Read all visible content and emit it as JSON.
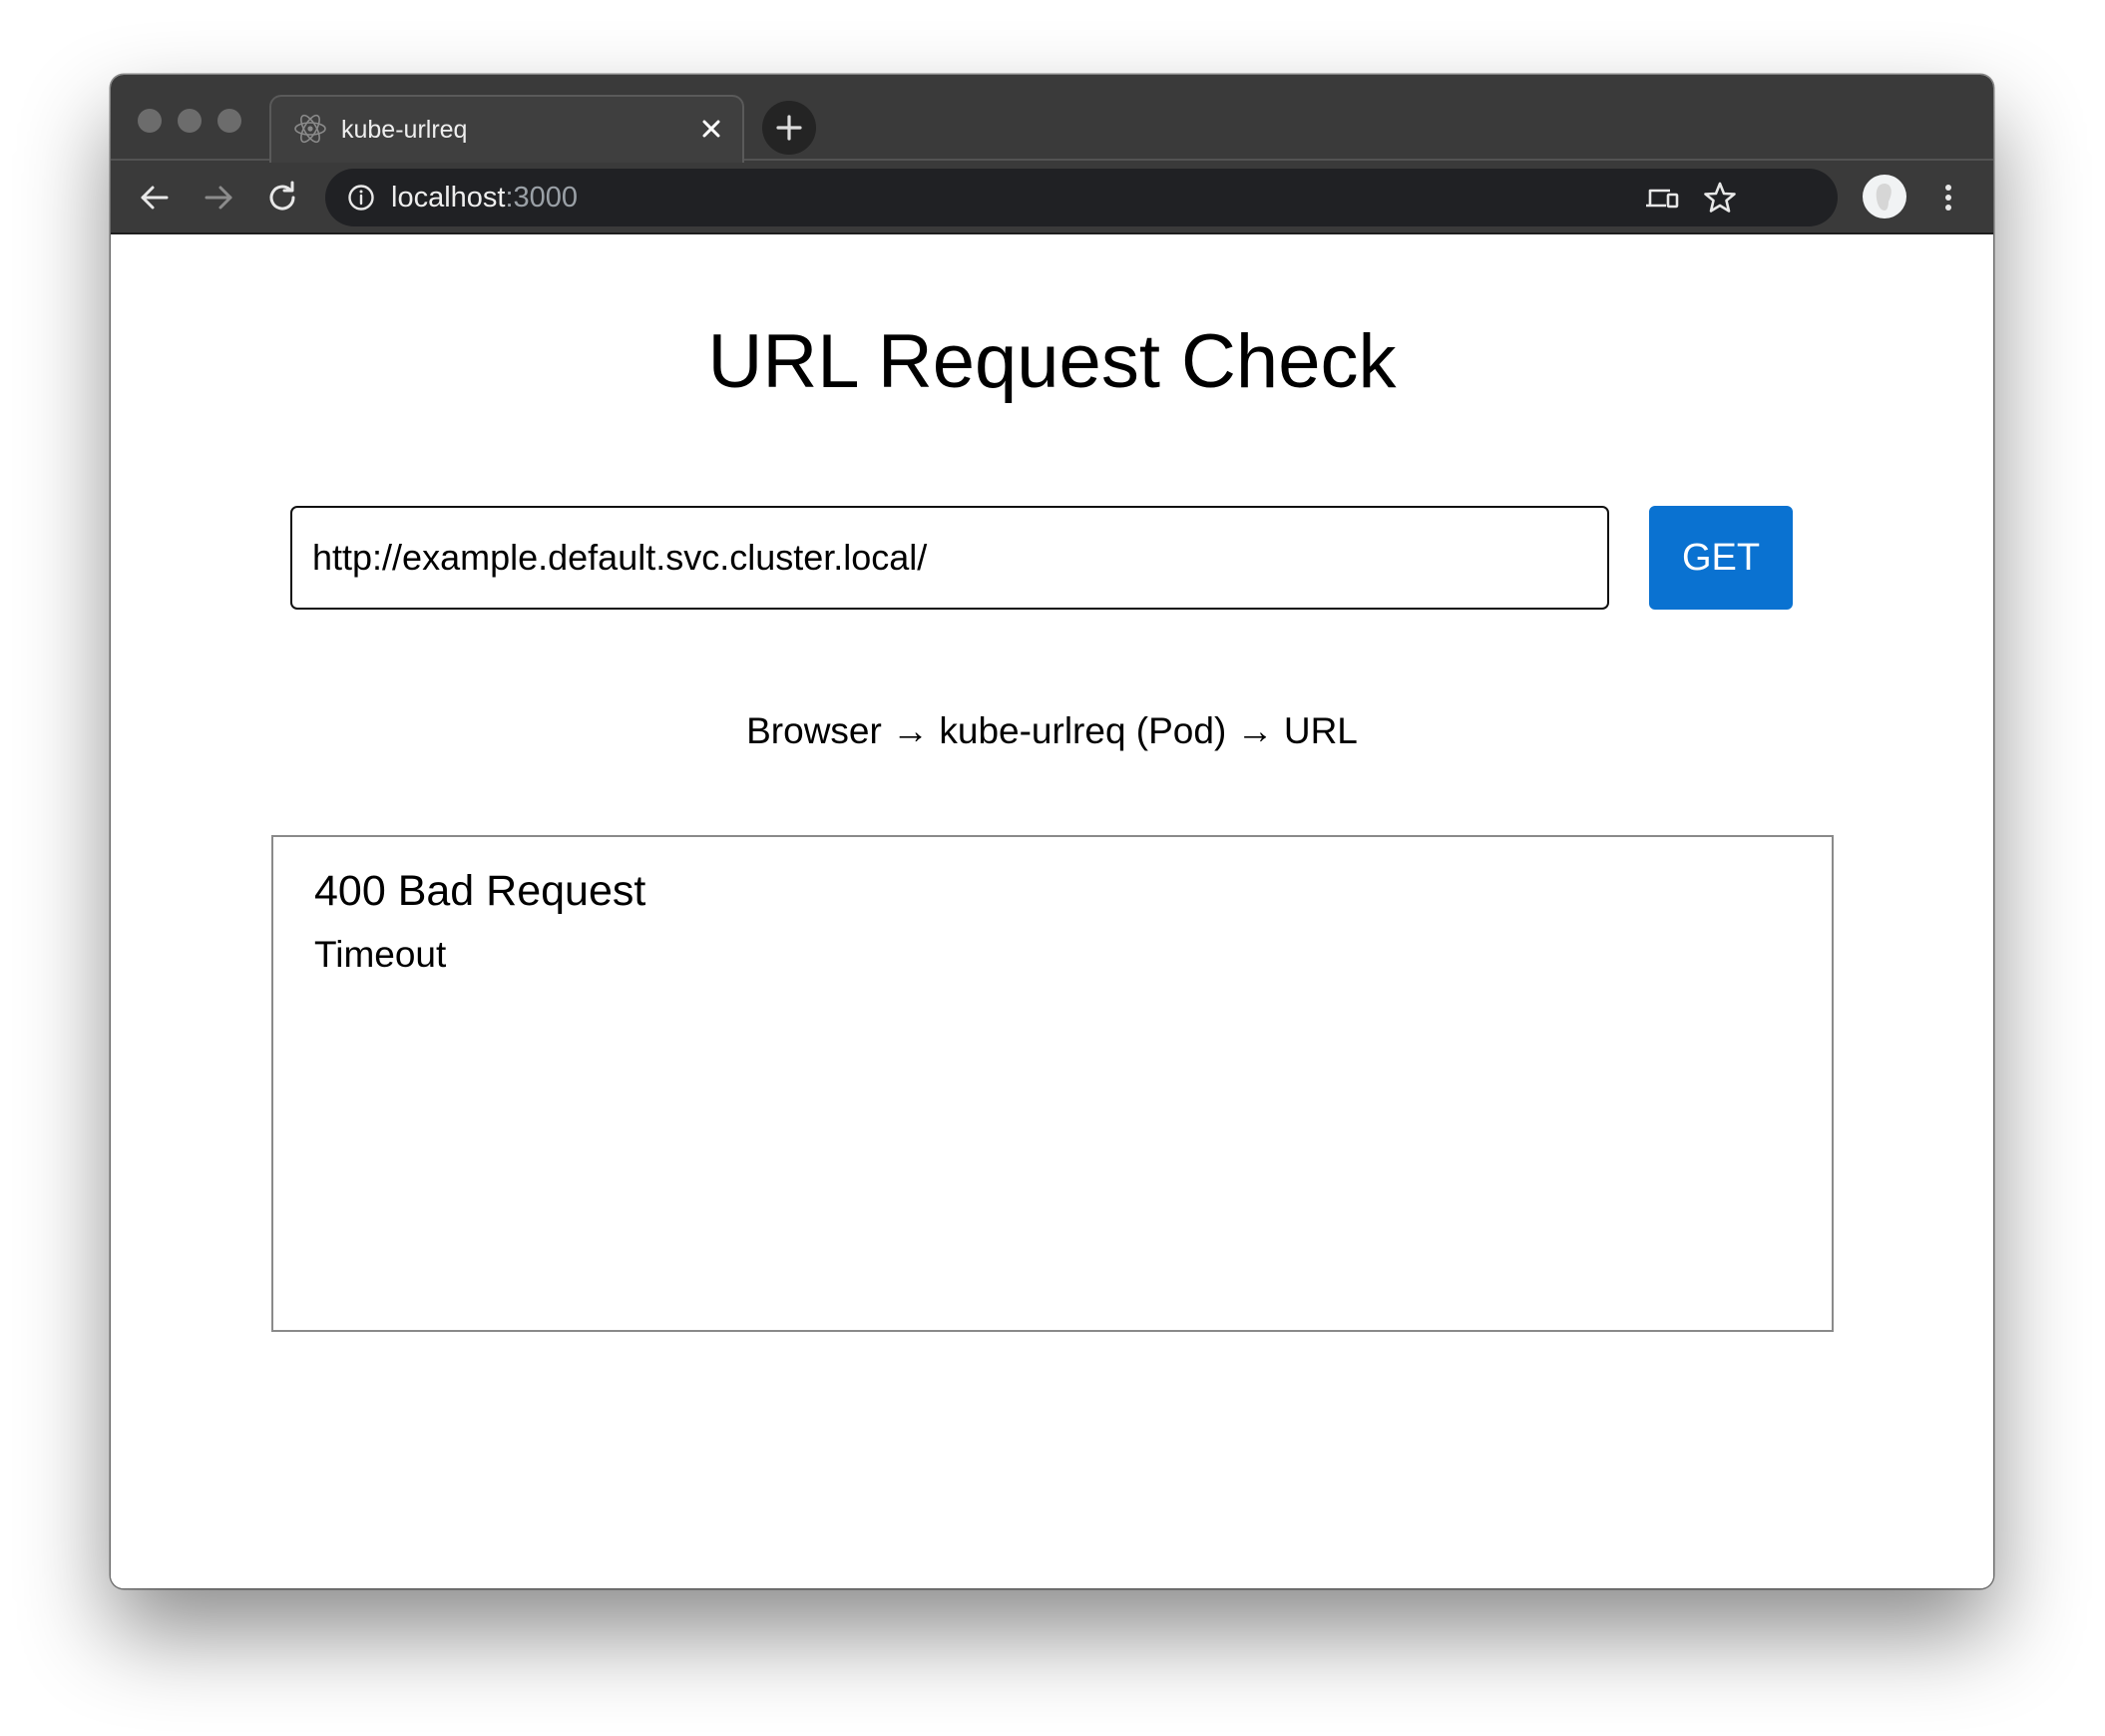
{
  "browser": {
    "tab": {
      "title": "kube-urlreq",
      "favicon": "react-atom-icon"
    },
    "address_bar": {
      "host": "localhost",
      "port": ":3000"
    },
    "colors": {
      "frame": "#3a3a3a",
      "omnibox": "#202124"
    }
  },
  "page": {
    "title": "URL Request Check",
    "url_input": {
      "value": "http://example.default.svc.cluster.local/",
      "placeholder": ""
    },
    "get_button": {
      "label": "GET",
      "color": "#0a72d1"
    },
    "flow_text": "Browser → kube-urlreq (Pod) → URL",
    "result": {
      "status": "400 Bad Request",
      "detail": "Timeout"
    }
  }
}
